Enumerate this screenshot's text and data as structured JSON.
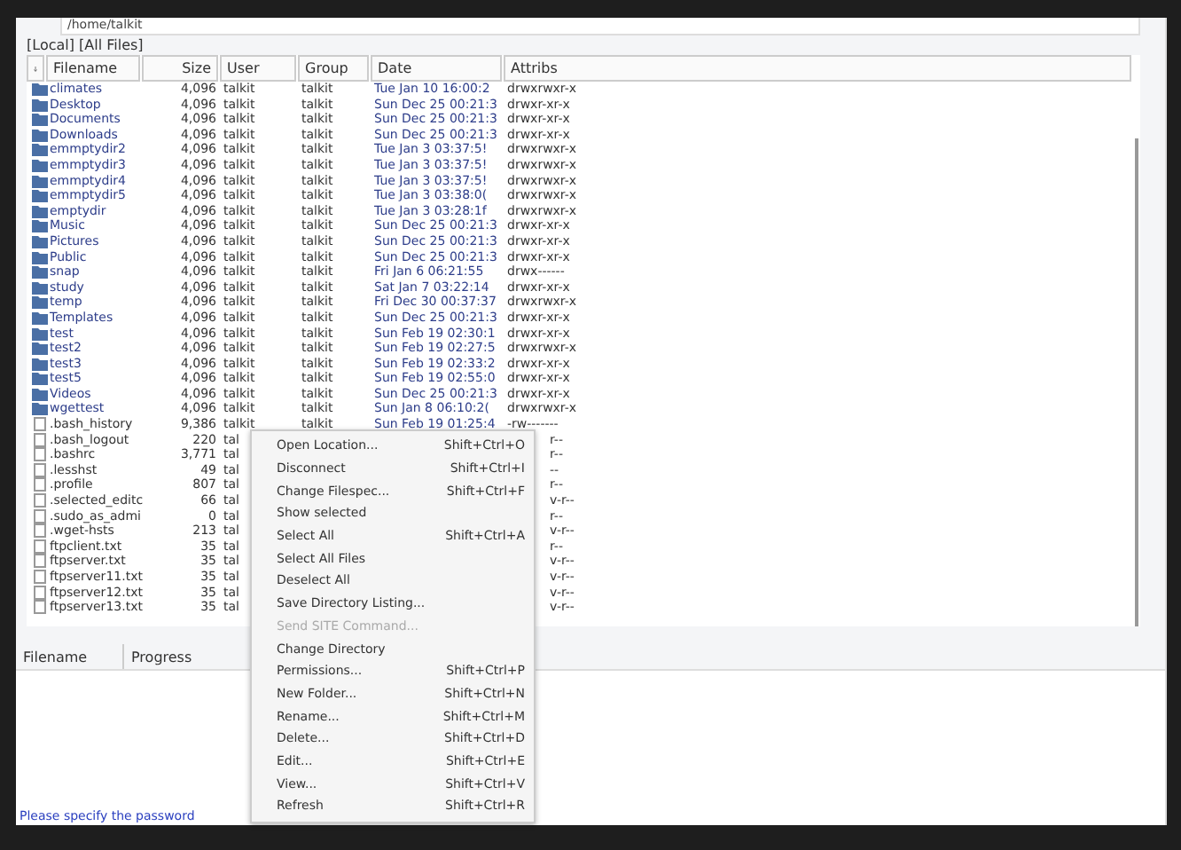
{
  "path_field": {
    "value": "/home/talkit"
  },
  "filter_label": "[Local] [All Files]",
  "file_table": {
    "columns": [
      "Filename",
      "Size",
      "User",
      "Group",
      "Date",
      "Attribs"
    ],
    "rows": [
      {
        "kind": "folder",
        "name": "climates",
        "size": "4,096",
        "user": "talkit",
        "group": "talkit",
        "date": "Tue Jan 10 16:00:2",
        "attribs": "drwxrwxr-x"
      },
      {
        "kind": "folder",
        "name": "Desktop",
        "size": "4,096",
        "user": "talkit",
        "group": "talkit",
        "date": "Sun Dec 25 00:21:3",
        "attribs": "drwxr-xr-x"
      },
      {
        "kind": "folder",
        "name": "Documents",
        "size": "4,096",
        "user": "talkit",
        "group": "talkit",
        "date": "Sun Dec 25 00:21:3",
        "attribs": "drwxr-xr-x"
      },
      {
        "kind": "folder",
        "name": "Downloads",
        "size": "4,096",
        "user": "talkit",
        "group": "talkit",
        "date": "Sun Dec 25 00:21:3",
        "attribs": "drwxr-xr-x"
      },
      {
        "kind": "folder",
        "name": "emmptydir2",
        "size": "4,096",
        "user": "talkit",
        "group": "talkit",
        "date": "Tue Jan  3 03:37:5!",
        "attribs": "drwxrwxr-x"
      },
      {
        "kind": "folder",
        "name": "emmptydir3",
        "size": "4,096",
        "user": "talkit",
        "group": "talkit",
        "date": "Tue Jan  3 03:37:5!",
        "attribs": "drwxrwxr-x"
      },
      {
        "kind": "folder",
        "name": "emmptydir4",
        "size": "4,096",
        "user": "talkit",
        "group": "talkit",
        "date": "Tue Jan  3 03:37:5!",
        "attribs": "drwxrwxr-x"
      },
      {
        "kind": "folder",
        "name": "emmptydir5",
        "size": "4,096",
        "user": "talkit",
        "group": "talkit",
        "date": "Tue Jan  3 03:38:0(",
        "attribs": "drwxrwxr-x"
      },
      {
        "kind": "folder",
        "name": "emptydir",
        "size": "4,096",
        "user": "talkit",
        "group": "talkit",
        "date": "Tue Jan  3 03:28:1f",
        "attribs": "drwxrwxr-x"
      },
      {
        "kind": "folder",
        "name": "Music",
        "size": "4,096",
        "user": "talkit",
        "group": "talkit",
        "date": "Sun Dec 25 00:21:3",
        "attribs": "drwxr-xr-x"
      },
      {
        "kind": "folder",
        "name": "Pictures",
        "size": "4,096",
        "user": "talkit",
        "group": "talkit",
        "date": "Sun Dec 25 00:21:3",
        "attribs": "drwxr-xr-x"
      },
      {
        "kind": "folder",
        "name": "Public",
        "size": "4,096",
        "user": "talkit",
        "group": "talkit",
        "date": "Sun Dec 25 00:21:3",
        "attribs": "drwxr-xr-x"
      },
      {
        "kind": "folder",
        "name": "snap",
        "size": "4,096",
        "user": "talkit",
        "group": "talkit",
        "date": "Fri Jan  6 06:21:55",
        "attribs": "drwx------"
      },
      {
        "kind": "folder",
        "name": "study",
        "size": "4,096",
        "user": "talkit",
        "group": "talkit",
        "date": "Sat Jan  7 03:22:14",
        "attribs": "drwxr-xr-x"
      },
      {
        "kind": "folder",
        "name": "temp",
        "size": "4,096",
        "user": "talkit",
        "group": "talkit",
        "date": "Fri Dec 30 00:37:37",
        "attribs": "drwxrwxr-x"
      },
      {
        "kind": "folder",
        "name": "Templates",
        "size": "4,096",
        "user": "talkit",
        "group": "talkit",
        "date": "Sun Dec 25 00:21:3",
        "attribs": "drwxr-xr-x"
      },
      {
        "kind": "folder",
        "name": "test",
        "size": "4,096",
        "user": "talkit",
        "group": "talkit",
        "date": "Sun Feb 19 02:30:1",
        "attribs": "drwxr-xr-x"
      },
      {
        "kind": "folder",
        "name": "test2",
        "size": "4,096",
        "user": "talkit",
        "group": "talkit",
        "date": "Sun Feb 19 02:27:5",
        "attribs": "drwxrwxr-x"
      },
      {
        "kind": "folder",
        "name": "test3",
        "size": "4,096",
        "user": "talkit",
        "group": "talkit",
        "date": "Sun Feb 19 02:33:2",
        "attribs": "drwxr-xr-x"
      },
      {
        "kind": "folder",
        "name": "test5",
        "size": "4,096",
        "user": "talkit",
        "group": "talkit",
        "date": "Sun Feb 19 02:55:0",
        "attribs": "drwxr-xr-x"
      },
      {
        "kind": "folder",
        "name": "Videos",
        "size": "4,096",
        "user": "talkit",
        "group": "talkit",
        "date": "Sun Dec 25 00:21:3",
        "attribs": "drwxr-xr-x"
      },
      {
        "kind": "folder",
        "name": "wgettest",
        "size": "4,096",
        "user": "talkit",
        "group": "talkit",
        "date": "Sun Jan  8 06:10:2(",
        "attribs": "drwxrwxr-x"
      },
      {
        "kind": "file",
        "name": ".bash_history",
        "size": "9,386",
        "user": "talkit",
        "group": "talkit",
        "date": "Sun Feb 19 01:25:4",
        "attribs": "-rw-------"
      },
      {
        "kind": "file",
        "name": ".bash_logout",
        "size": "220",
        "user": "tal",
        "attribs": "r--"
      },
      {
        "kind": "file",
        "name": ".bashrc",
        "size": "3,771",
        "user": "tal",
        "attribs": "r--"
      },
      {
        "kind": "file",
        "name": ".lesshst",
        "size": "49",
        "user": "tal",
        "attribs": "--"
      },
      {
        "kind": "file",
        "name": ".profile",
        "size": "807",
        "user": "tal",
        "attribs": "r--"
      },
      {
        "kind": "file",
        "name": ".selected_editc",
        "size": "66",
        "user": "tal",
        "attribs": "v-r--"
      },
      {
        "kind": "file",
        "name": ".sudo_as_admi",
        "size": "0",
        "user": "tal",
        "attribs": "r--"
      },
      {
        "kind": "file",
        "name": ".wget-hsts",
        "size": "213",
        "user": "tal",
        "attribs": "v-r--"
      },
      {
        "kind": "file",
        "name": "ftpclient.txt",
        "size": "35",
        "user": "tal",
        "attribs": "r--"
      },
      {
        "kind": "file",
        "name": "ftpserver.txt",
        "size": "35",
        "user": "tal",
        "attribs": "v-r--"
      },
      {
        "kind": "file",
        "name": "ftpserver11.txt",
        "size": "35",
        "user": "tal",
        "attribs": "v-r--"
      },
      {
        "kind": "file",
        "name": "ftpserver12.txt",
        "size": "35",
        "user": "tal",
        "attribs": "v-r--"
      },
      {
        "kind": "file",
        "name": "ftpserver13.txt",
        "size": "35",
        "user": "tal",
        "attribs": "v-r--"
      }
    ]
  },
  "transfer_table": {
    "columns": [
      "Filename",
      "Progress"
    ]
  },
  "status_message": "Please specify the password",
  "context_menu": [
    {
      "label": "Open Location...",
      "shortcut": "Shift+Ctrl+O",
      "disabled": false
    },
    {
      "label": "Disconnect",
      "shortcut": "Shift+Ctrl+I",
      "disabled": false
    },
    {
      "label": "Change Filespec...",
      "shortcut": "Shift+Ctrl+F",
      "disabled": false
    },
    {
      "label": "Show selected",
      "disabled": false
    },
    {
      "label": "Select All",
      "shortcut": "Shift+Ctrl+A",
      "disabled": false
    },
    {
      "label": "Select All Files",
      "disabled": false
    },
    {
      "label": "Deselect All",
      "disabled": false
    },
    {
      "label": "Save Directory Listing...",
      "disabled": false
    },
    {
      "label": "Send SITE Command...",
      "disabled": true
    },
    {
      "label": "Change Directory",
      "disabled": false
    },
    {
      "label": "Permissions...",
      "shortcut": "Shift+Ctrl+P",
      "disabled": false
    },
    {
      "label": "New Folder...",
      "shortcut": "Shift+Ctrl+N",
      "disabled": false
    },
    {
      "label": "Rename...",
      "shortcut": "Shift+Ctrl+M",
      "disabled": false
    },
    {
      "label": "Delete...",
      "shortcut": "Shift+Ctrl+D",
      "disabled": false
    },
    {
      "label": "Edit...",
      "shortcut": "Shift+Ctrl+E",
      "disabled": false
    },
    {
      "label": "View...",
      "shortcut": "Shift+Ctrl+V",
      "disabled": false
    },
    {
      "label": "Refresh",
      "shortcut": "Shift+Ctrl+R",
      "disabled": false
    }
  ]
}
